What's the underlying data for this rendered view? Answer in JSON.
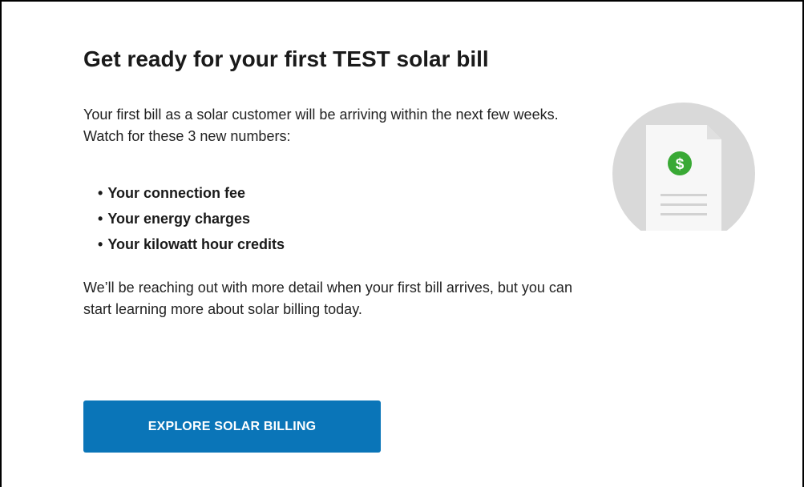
{
  "card": {
    "title": "Get ready for your first TEST solar bill",
    "intro": "Your first bill as a solar customer will be arriving within the next few weeks. Watch for these 3 new numbers:",
    "bullets": [
      "Your connection fee",
      "Your energy charges",
      "Your kilowatt hour credits"
    ],
    "closing": "We’ll be reaching out with more detail when your first bill arrives, but you can start learning more about solar billing today.",
    "cta_label": "EXPLORE SOLAR BILLING"
  },
  "illustration": {
    "icon": "bill-document-icon",
    "badge_symbol": "$",
    "colors": {
      "circle": "#d9d9d9",
      "paper": "#f7f7f7",
      "badge": "#39a935"
    }
  },
  "colors": {
    "button": "#0a75b8",
    "text": "#1a1a1a"
  }
}
